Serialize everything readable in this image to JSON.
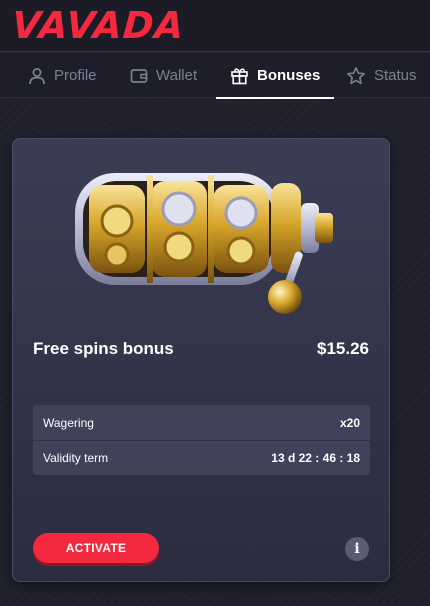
{
  "brand": {
    "logo_text": "VAVADA",
    "accent_color": "#f4283f"
  },
  "nav": {
    "tabs": [
      {
        "label": "Profile",
        "icon": "user-icon",
        "active": false
      },
      {
        "label": "Wallet",
        "icon": "wallet-icon",
        "active": false
      },
      {
        "label": "Bonuses",
        "icon": "gift-icon",
        "active": true
      },
      {
        "label": "Status",
        "icon": "star-icon",
        "active": false
      }
    ]
  },
  "bonus_card": {
    "image": "slot-machine-reels-illustration",
    "title": "Free spins bonus",
    "amount": "$15.26",
    "details": [
      {
        "label": "Wagering",
        "value": "x20"
      },
      {
        "label": "Validity term",
        "value": "13 d 22 : 46 : 18"
      }
    ],
    "activate_label": "ACTIVATE",
    "info_label": "i"
  }
}
